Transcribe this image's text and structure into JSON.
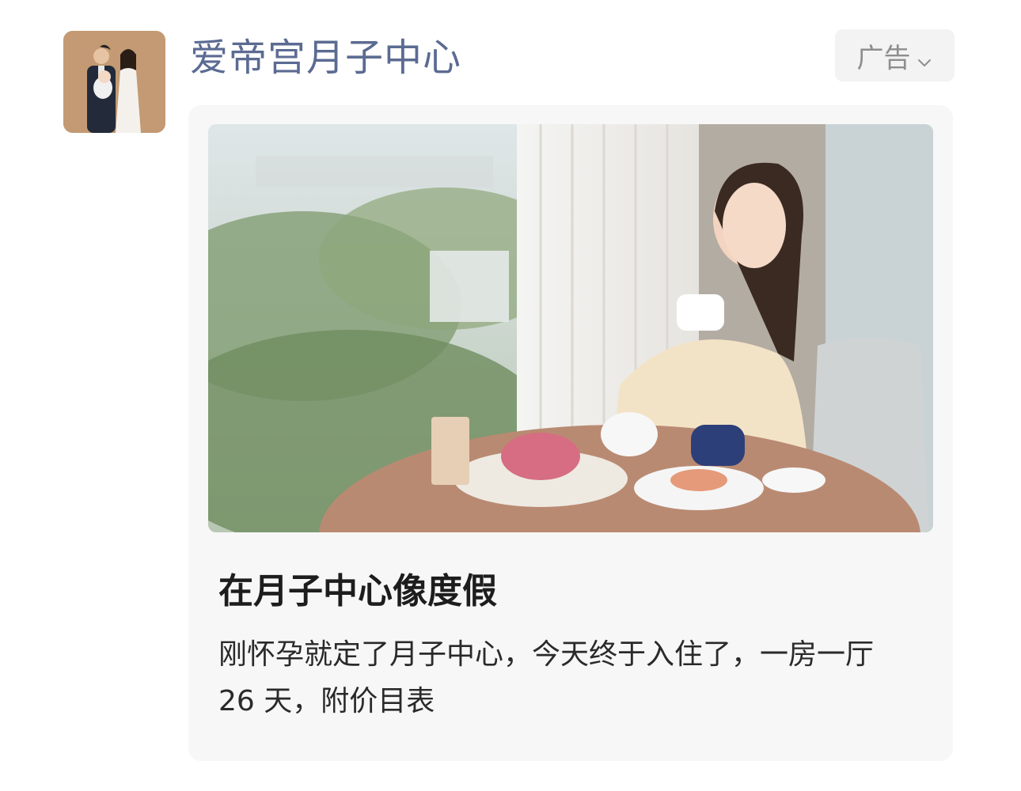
{
  "account": {
    "name": "爱帝宫月子中心",
    "avatar_icon": "family-photo-avatar"
  },
  "ad_tag": {
    "label": "广告",
    "icon": "chevron-down-icon"
  },
  "post": {
    "title": "在月子中心像度假",
    "description": "刚怀孕就定了月子中心，今天终于入住了，一房一厅 26 天，附价目表",
    "image": "woman-dining-by-window-photo"
  },
  "colors": {
    "account_name": "#5b6b92",
    "card_bg": "#f7f7f7",
    "ad_bg": "#f3f3f3",
    "ad_text": "#8e8e8e"
  }
}
